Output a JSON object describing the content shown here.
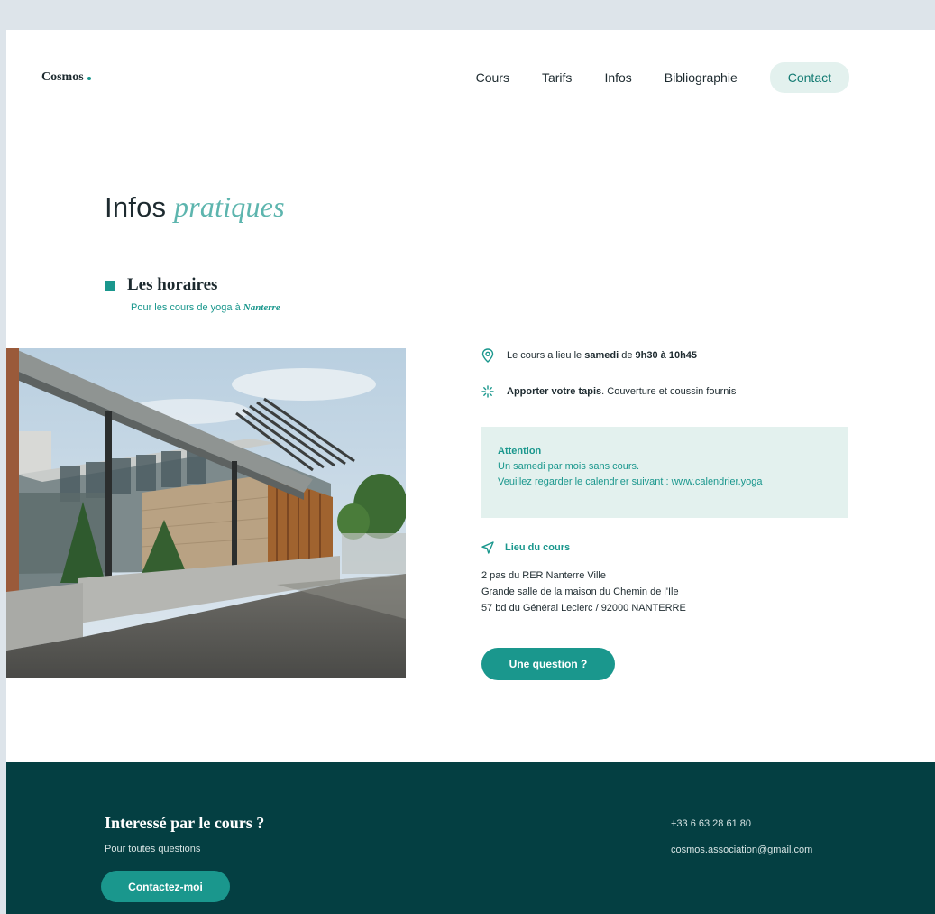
{
  "header": {
    "logo": "Cosmos",
    "nav": [
      {
        "label": "Cours"
      },
      {
        "label": "Tarifs"
      },
      {
        "label": "Infos"
      },
      {
        "label": "Bibliographie"
      }
    ],
    "contact_label": "Contact"
  },
  "page_title": {
    "plain": "Infos",
    "italic": "pratiques"
  },
  "schedule": {
    "title": "Les horaires",
    "subtitle_prefix": "Pour les cours de yoga à",
    "subtitle_place": "Nanterre"
  },
  "info": {
    "time_prefix": "Le cours a lieu le",
    "time_day": "samedi",
    "time_mid": "de",
    "time_range": "9h30 à 10h45",
    "mat_bold": "Apporter votre tapis",
    "mat_rest": ". Couverture et coussin fournis"
  },
  "alert": {
    "title": "Attention",
    "line1": "Un samedi par mois sans cours.",
    "line2": "Veuillez regarder le calendrier suivant : www.calendrier.yoga"
  },
  "location": {
    "title": "Lieu du cours",
    "lines": [
      "2 pas du RER Nanterre Ville",
      "Grande salle de la maison du Chemin de l'Ile",
      "57 bd du Général Leclerc / 92000 NANTERRE"
    ]
  },
  "question_button": "Une question ?",
  "footer": {
    "title": "Interessé par le cours ?",
    "subtitle": "Pour toutes questions",
    "button": "Contactez-moi",
    "phone": "+33  6 63 28 61 80",
    "email": "cosmos.association@gmail.com"
  },
  "colors": {
    "accent": "#1a978d",
    "accent_light": "#e3f1ee",
    "footer_bg": "#043f42",
    "title_italic": "#5db5ae"
  }
}
